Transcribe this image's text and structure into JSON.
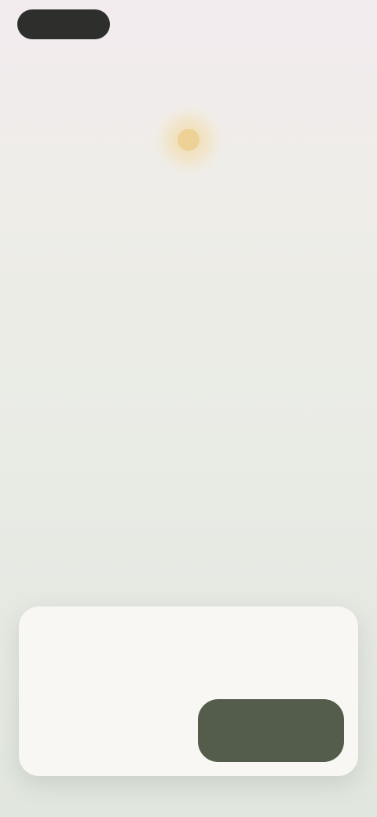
{
  "topbar": {
    "back_label": "",
    "right_label": ""
  },
  "hero": {
    "icon": "sun-icon",
    "title": ""
  },
  "list": {
    "items": [
      {
        "title": "",
        "value": "",
        "description": ""
      },
      {
        "title": "",
        "value": "",
        "description": ""
      },
      {
        "title": "",
        "value": "",
        "description": ""
      }
    ]
  },
  "sheet": {
    "title": "",
    "body": "",
    "secondary_label": "",
    "primary_label": ""
  },
  "colors": {
    "primary_button": "#545c4c",
    "back_pill": "#2e2f2c",
    "accent_sun": "#f0d9a2"
  }
}
